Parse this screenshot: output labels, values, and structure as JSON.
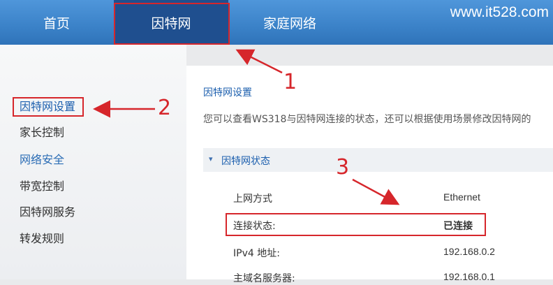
{
  "watermark": "www.it528.com",
  "nav": {
    "tabs": [
      {
        "label": "首页"
      },
      {
        "label": "因特网"
      },
      {
        "label": "家庭网络"
      }
    ]
  },
  "sidebar": {
    "items": [
      {
        "label": "因特网设置"
      },
      {
        "label": "家长控制"
      },
      {
        "label": "网络安全"
      },
      {
        "label": "带宽控制"
      },
      {
        "label": "因特网服务"
      },
      {
        "label": "转发规则"
      }
    ]
  },
  "panel": {
    "title": "因特网设置",
    "description": "您可以查看WS318与因特网连接的状态，还可以根据使用场景修改因特网的",
    "section": {
      "title": "因特网状态",
      "rows": [
        {
          "label": "上网方式",
          "value": "Ethernet"
        },
        {
          "label": "连接状态:",
          "value": "已连接"
        },
        {
          "label": "IPv4 地址:",
          "value": "192.168.0.2"
        },
        {
          "label": "主域名服务器:",
          "value": "192.168.0.1"
        }
      ]
    }
  },
  "annotations": {
    "n1": "1",
    "n2": "2",
    "n3": "3",
    "color": "#d6262b"
  }
}
